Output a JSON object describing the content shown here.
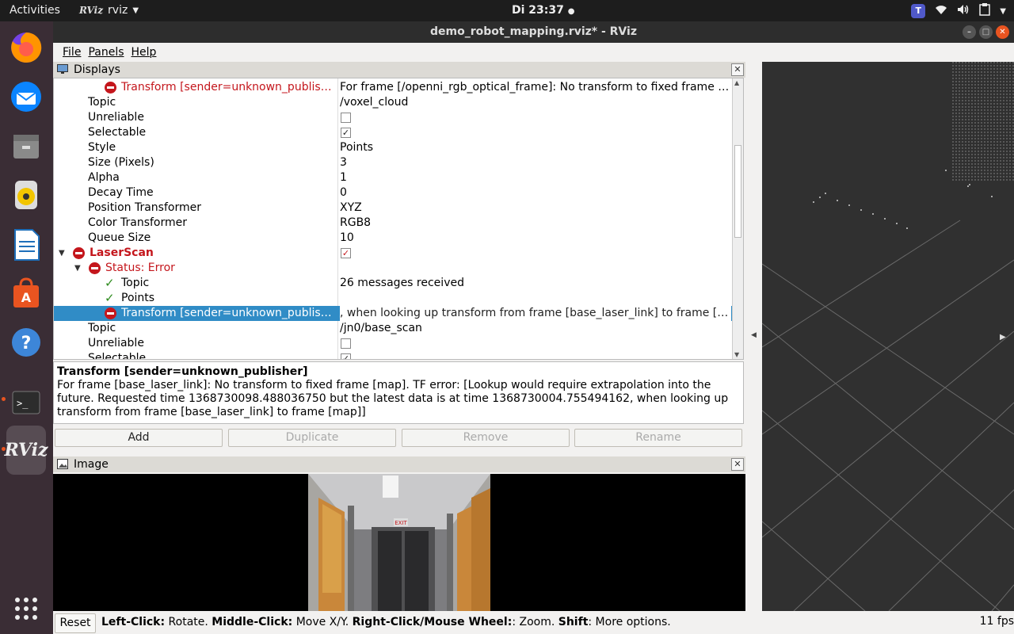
{
  "topbar": {
    "activities": "Activities",
    "app_name": "rviz",
    "app_logo": "RViz",
    "clock": "Di 23:37"
  },
  "dock": {
    "items": [
      "firefox-icon",
      "thunderbird-icon",
      "files-icon",
      "rhythmbox-icon",
      "libreoffice-writer-icon",
      "software-center-icon",
      "help-icon",
      "terminal-icon",
      "rviz-icon",
      "show-apps-icon"
    ]
  },
  "window": {
    "title": "demo_robot_mapping.rviz* - RViz",
    "menus": [
      "File",
      "Panels",
      "Help"
    ]
  },
  "displays": {
    "title": "Displays",
    "rows": [
      {
        "name": "Transform [sender=unknown_publish…",
        "value": "For frame [/openni_rgb_optical_frame]: No transform to fixed frame […"
      },
      {
        "name": "Topic",
        "value": "/voxel_cloud"
      },
      {
        "name": "Unreliable",
        "value": ""
      },
      {
        "name": "Selectable",
        "value": ""
      },
      {
        "name": "Style",
        "value": "Points"
      },
      {
        "name": "Size (Pixels)",
        "value": "3"
      },
      {
        "name": "Alpha",
        "value": "1"
      },
      {
        "name": "Decay Time",
        "value": "0"
      },
      {
        "name": "Position Transformer",
        "value": "XYZ"
      },
      {
        "name": "Color Transformer",
        "value": "RGB8"
      },
      {
        "name": "Queue Size",
        "value": "10"
      },
      {
        "name": "LaserScan",
        "value": ""
      },
      {
        "name": "Status: Error",
        "value": ""
      },
      {
        "name": "Topic",
        "value": "26 messages received"
      },
      {
        "name": "Points",
        "value": ""
      },
      {
        "name": "Transform [sender=unknown_publish…",
        "value": ", when looking up transform from frame [base_laser_link] to frame [map]]"
      },
      {
        "name": "Topic",
        "value": "/jn0/base_scan"
      },
      {
        "name": "Unreliable",
        "value": ""
      },
      {
        "name": "Selectable",
        "value": ""
      }
    ],
    "description_title": "Transform [sender=unknown_publisher]",
    "description_text": "For frame [base_laser_link]: No transform to fixed frame [map]. TF error: [Lookup would require extrapolation into the future.  Requested time 1368730098.488036750 but the latest data is at time 1368730004.755494162, when looking up transform from frame [base_laser_link] to frame [map]]",
    "buttons": {
      "add": "Add",
      "duplicate": "Duplicate",
      "remove": "Remove",
      "rename": "Rename"
    }
  },
  "image_panel": {
    "title": "Image",
    "exit_sign": "EXIT"
  },
  "statusbar": {
    "reset": "Reset",
    "hint_parts": [
      {
        "b": "Left-Click:",
        "t": " Rotate. "
      },
      {
        "b": "Middle-Click:",
        "t": " Move X/Y. "
      },
      {
        "b": "Right-Click/Mouse Wheel:",
        "t": ": Zoom. "
      },
      {
        "b": "Shift",
        "t": ": More options."
      }
    ],
    "fps": "11 fps"
  },
  "colors": {
    "error": "#c4161c",
    "ok": "#2e8b1e",
    "selection": "#308cc6",
    "ubuntu_orange": "#e95420"
  }
}
